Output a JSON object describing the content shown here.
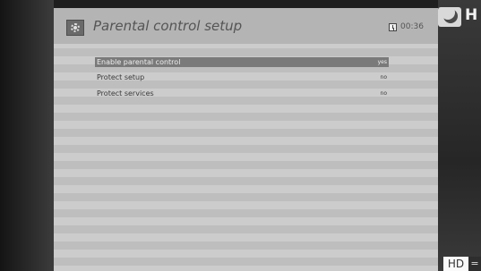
{
  "header": {
    "title": "Parental control setup",
    "time": "00:36"
  },
  "menu": {
    "items": [
      {
        "label": "Enable parental control",
        "value": "yes",
        "selected": true
      },
      {
        "label": "Protect setup",
        "value": "no",
        "selected": false
      },
      {
        "label": "Protect services",
        "value": "no",
        "selected": false
      }
    ]
  },
  "overlay": {
    "channel_logo_letter": "H",
    "hd_badge": "HD",
    "hd_badge_extra": "="
  },
  "icons": {
    "header_icon": "gear-icon",
    "time_icon": "clock-icon",
    "channel_logo": "crescent-logo"
  },
  "colors": {
    "highlight": "#7a7a7a",
    "panel": "#cccccc"
  }
}
